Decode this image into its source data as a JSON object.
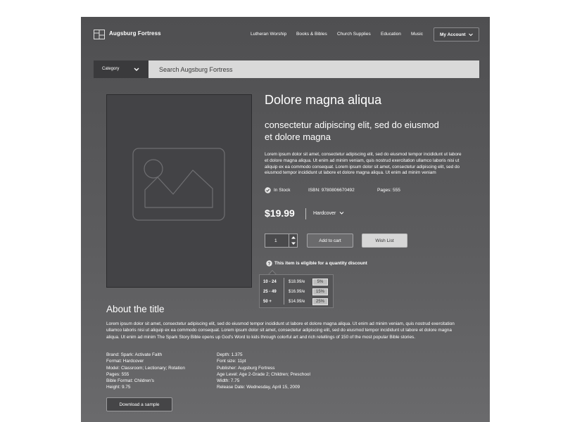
{
  "brand": {
    "name": "Augsburg Fortress",
    "logo": "augsburg-fortress-logo"
  },
  "nav": {
    "items": [
      {
        "label": "Lutheran Worship"
      },
      {
        "label": "Books & Bibles"
      },
      {
        "label": "Church Supplies"
      },
      {
        "label": "Education"
      },
      {
        "label": "Music"
      }
    ],
    "account_label": "My Account"
  },
  "search": {
    "category_label": "Category",
    "placeholder": "Search Augsburg Fortress"
  },
  "product": {
    "image_icon": "image-placeholder-icon",
    "title": "Dolore magna aliqua",
    "subtitle": "consectetur adipiscing elit, sed do eiusmod et dolore magna",
    "description": "Lorem ipsum dolor sit amet, consectetur adipiscing elit, sed do eiusmod tempor incididunt ut labore et dolore magna aliqua. Ut enim ad minim veniam, quis nostrud exercitation ullamco laboris nisi ut aliquip ex ea commodo consequat. Lorem ipsum dolor sit amet, consectetur adipiscing elit, sed do eiusmod tempor incididunt ut labore et dolore magna aliqua. Ut enim ad minim veniam",
    "stock": "In Stock",
    "isbn": "ISBN: 9780806670492",
    "pages": "Pages: 555",
    "price": "$19.99",
    "format": "Hardcover",
    "quantity": "1",
    "add_to_cart": "Add to cart",
    "wish_list": "Wish List",
    "discount_note": "This item is eligible for a quantity discount",
    "discounts": [
      {
        "range": "10 - 24",
        "price": "$18.99/e",
        "pct": "5%"
      },
      {
        "range": "25 - 49",
        "price": "$16.99/e",
        "pct": "15%"
      },
      {
        "range": "50 +",
        "price": "$14.99/e",
        "pct": "25%"
      }
    ]
  },
  "about": {
    "heading": "About the title",
    "text": "Lorem ipsum dolor sit amet, consectetur adipiscing elit, sed do eiusmod tempor incididunt ut labore et dolore magna aliqua. Ut enim ad minim veniam, quis nostrud exercitation ullamco laboris nisi ut aliquip ex ea commodo consequat. Lorem ipsum dolor sit amet, consectetur adipiscing elit, sed do eiusmod tempor incididunt ut labore et dolore magna aliqua. Ut enim ad minim The Spark Story Bible opens up God's Word to kids through colorful art and rich retellings of 150 of the most popular Bible stories.",
    "specs_left": [
      "Brand: Spark: Activate Faith",
      "Format: Hardcover",
      "Model: Classroom; Lectionary; Rotation",
      "Pages: 555",
      "Bible Format: Children's",
      "Height: 9.75"
    ],
    "specs_right": [
      "Depth: 1.375",
      "Font size: 11pt",
      "Publisher: Augsburg Fortress",
      "Age Level: Age 2-Grade 2; Children; Preschool",
      "Width: 7.75",
      "Release Date: Wednesday, April 15, 2009"
    ],
    "download_label": "Download a sample"
  }
}
